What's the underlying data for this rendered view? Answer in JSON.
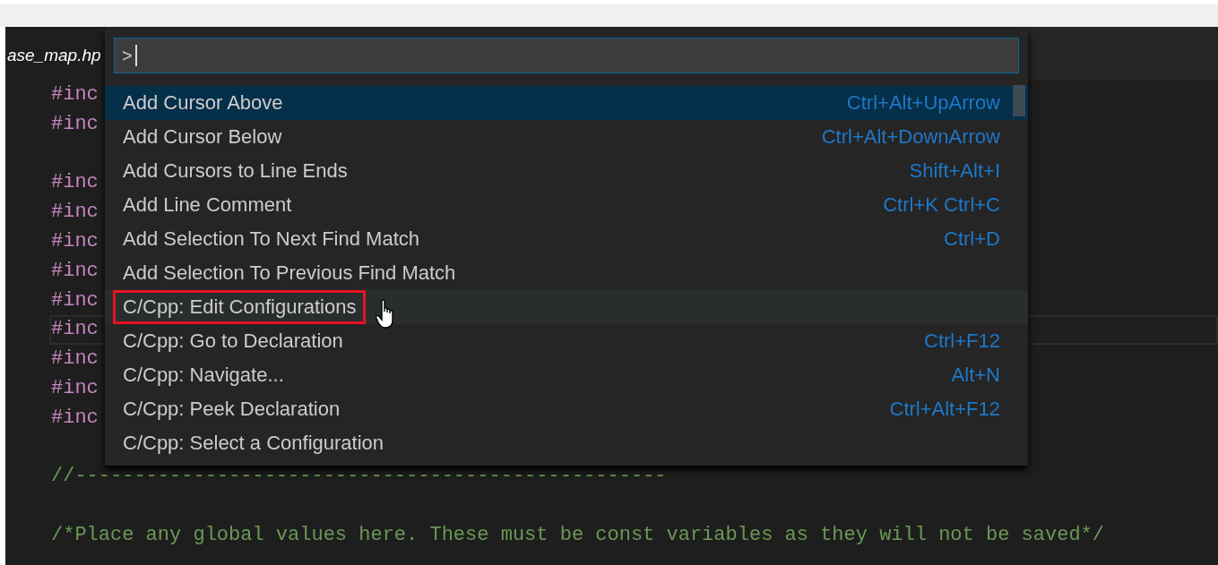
{
  "tab": {
    "label": "ase_map.hp"
  },
  "code_lines": [
    {
      "kind": "include",
      "text": "#inc",
      "current": false
    },
    {
      "kind": "include",
      "text": "#inc",
      "current": false
    },
    {
      "kind": "blank"
    },
    {
      "kind": "include",
      "text": "#inc",
      "current": false
    },
    {
      "kind": "include",
      "text": "#inc",
      "current": false
    },
    {
      "kind": "include",
      "text": "#inc",
      "current": false
    },
    {
      "kind": "include",
      "text": "#inc",
      "current": false
    },
    {
      "kind": "include",
      "text": "#inc",
      "current": false
    },
    {
      "kind": "include",
      "text": "#inc",
      "current": true
    },
    {
      "kind": "include",
      "text": "#inc",
      "current": false
    },
    {
      "kind": "include",
      "text": "#inc",
      "current": false
    },
    {
      "kind": "include",
      "text": "#inc",
      "current": false
    },
    {
      "kind": "blank"
    },
    {
      "kind": "comment",
      "text": "//--------------------------------------------------",
      "current": false
    },
    {
      "kind": "blank"
    },
    {
      "kind": "comment",
      "text": "/*Place any global values here. These must be const variables as they will not be saved*/",
      "current": false
    }
  ],
  "command_palette": {
    "input": {
      "value": ">"
    },
    "items": [
      {
        "label": "Add Cursor Above",
        "keybinding": "Ctrl+Alt+UpArrow",
        "selected": true,
        "hovered": false,
        "outlined": false
      },
      {
        "label": "Add Cursor Below",
        "keybinding": "Ctrl+Alt+DownArrow",
        "selected": false,
        "hovered": false,
        "outlined": false
      },
      {
        "label": "Add Cursors to Line Ends",
        "keybinding": "Shift+Alt+I",
        "selected": false,
        "hovered": false,
        "outlined": false
      },
      {
        "label": "Add Line Comment",
        "keybinding": "Ctrl+K Ctrl+C",
        "selected": false,
        "hovered": false,
        "outlined": false
      },
      {
        "label": "Add Selection To Next Find Match",
        "keybinding": "Ctrl+D",
        "selected": false,
        "hovered": false,
        "outlined": false
      },
      {
        "label": "Add Selection To Previous Find Match",
        "selected": false,
        "hovered": false,
        "outlined": false
      },
      {
        "label": "C/Cpp: Edit Configurations",
        "selected": false,
        "hovered": true,
        "outlined": true
      },
      {
        "label": "C/Cpp: Go to Declaration",
        "keybinding": "Ctrl+F12",
        "selected": false,
        "hovered": false,
        "outlined": false
      },
      {
        "label": "C/Cpp: Navigate...",
        "keybinding": "Alt+N",
        "selected": false,
        "hovered": false,
        "outlined": false
      },
      {
        "label": "C/Cpp: Peek Declaration",
        "keybinding": "Ctrl+Alt+F12",
        "selected": false,
        "hovered": false,
        "outlined": false
      },
      {
        "label": "C/Cpp: Select a Configuration",
        "selected": false,
        "hovered": false,
        "outlined": false
      }
    ]
  }
}
